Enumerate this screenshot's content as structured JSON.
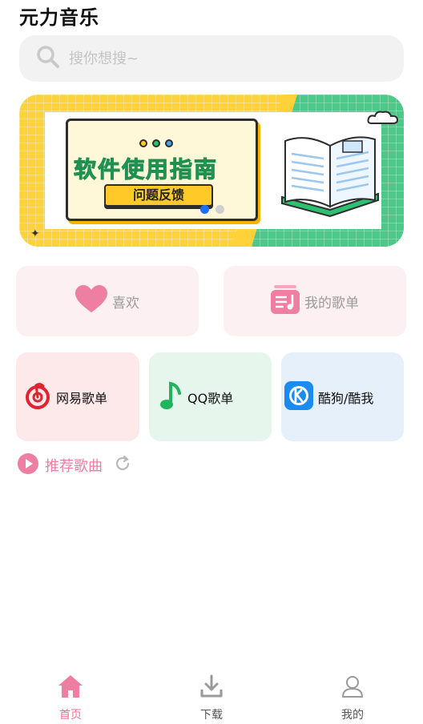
{
  "app": {
    "title": "元力音乐"
  },
  "search": {
    "placeholder": "搜你想搜~",
    "icon": "search-icon"
  },
  "banner": {
    "title": "软件使用指南",
    "button_label": "问题反馈",
    "pager": {
      "total": 2,
      "active": 0
    }
  },
  "quick_actions": [
    {
      "label": "喜欢",
      "icon": "heart-icon"
    },
    {
      "label": "我的歌单",
      "icon": "playlist-icon"
    }
  ],
  "import_sources": [
    {
      "label": "网易歌单",
      "icon": "netease-music-icon"
    },
    {
      "label": "QQ歌单",
      "icon": "qq-music-icon"
    },
    {
      "label": "酷狗/酷我",
      "icon": "kugou-icon"
    }
  ],
  "recommend": {
    "label": "推荐歌曲",
    "icon": "play-circle-icon",
    "refresh_icon": "refresh-icon"
  },
  "tabbar": {
    "items": [
      {
        "label": "首页",
        "icon": "home-icon",
        "active": true
      },
      {
        "label": "下载",
        "icon": "download-icon",
        "active": false
      },
      {
        "label": "我的",
        "icon": "user-icon",
        "active": false
      }
    ]
  },
  "colors": {
    "accent_pink": "#ec6d93",
    "active_dot": "#1f6fff",
    "banner_yellow": "#ffd23a",
    "banner_green": "#4cc88a",
    "tile_pink": "#fdf0f3",
    "tile_red": "#fde8ea",
    "tile_green": "#e6f6ec",
    "tile_blue": "#e6f0fb"
  }
}
